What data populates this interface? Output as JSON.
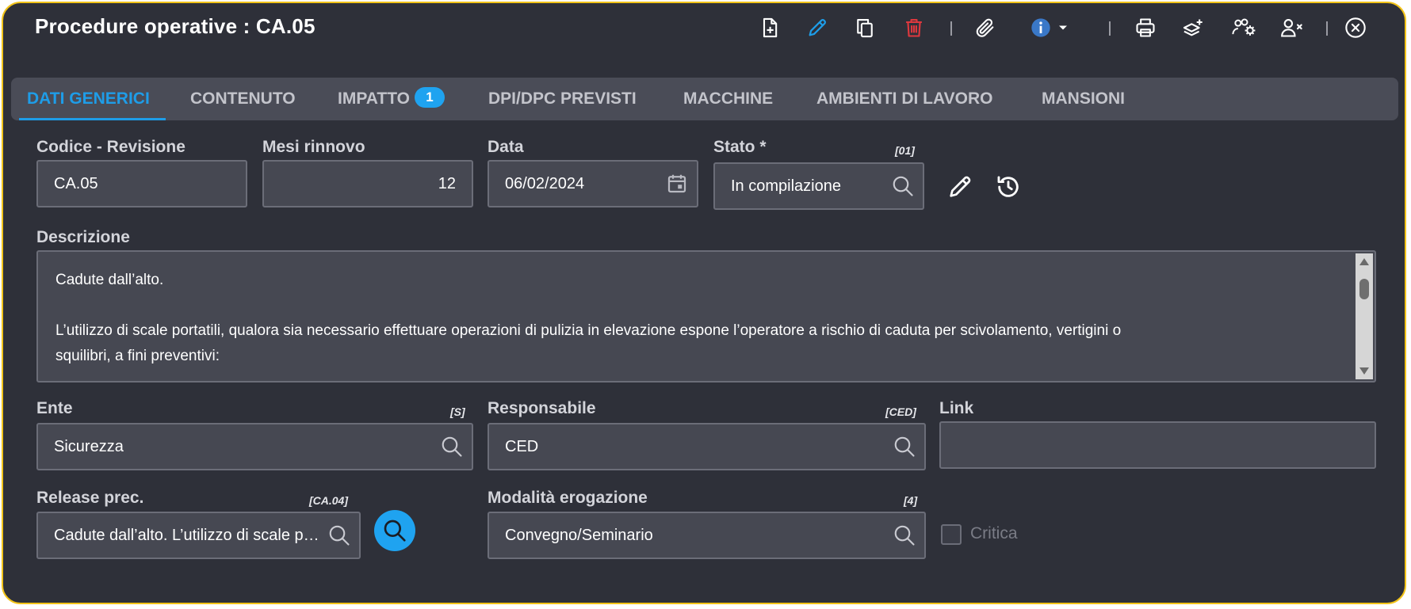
{
  "window": {
    "title": "Procedure operative : CA.05"
  },
  "toolbar": {
    "icons": [
      "new-document-icon",
      "edit-pencil-icon",
      "copy-icon",
      "delete-trash-icon",
      "attachment-icon",
      "info-icon",
      "chevron-down-icon",
      "print-icon",
      "layers-add-icon",
      "users-settings-icon",
      "user-remove-icon",
      "close-circle-icon"
    ]
  },
  "tabs": [
    {
      "label": "DATI GENERICI",
      "active": true
    },
    {
      "label": "CONTENUTO"
    },
    {
      "label": "IMPATTO",
      "badge": "1"
    },
    {
      "label": "DPI/DPC PREVISTI"
    },
    {
      "label": "MACCHINE"
    },
    {
      "label": "AMBIENTI DI LAVORO"
    },
    {
      "label": "MANSIONI"
    }
  ],
  "form": {
    "codice": {
      "label": "Codice - Revisione",
      "value": "CA.05"
    },
    "mesi": {
      "label": "Mesi rinnovo",
      "value": "12"
    },
    "data": {
      "label": "Data",
      "value": "06/02/2024"
    },
    "stato": {
      "label": "Stato *",
      "code": "[01]",
      "value": "In compilazione"
    },
    "descrizione": {
      "label": "Descrizione",
      "line1": "Cadute dall’alto.",
      "line2": "L’utilizzo di scale portatili, qualora sia necessario effettuare operazioni di pulizia in elevazione espone l’operatore a rischio di caduta per scivolamento, vertigini o",
      "line3": "squilibri, a fini preventivi:"
    },
    "ente": {
      "label": "Ente",
      "code": "[S]",
      "value": "Sicurezza"
    },
    "responsabile": {
      "label": "Responsabile",
      "code": "[CED]",
      "value": "CED"
    },
    "link": {
      "label": "Link",
      "value": ""
    },
    "release": {
      "label": "Release prec.",
      "code": "[CA.04]",
      "value": "Cadute dall’alto.  L’utilizzo di scale portatili"
    },
    "modalita": {
      "label": "Modalità erogazione",
      "code": "[4]",
      "value": "Convegno/Seminario"
    },
    "critica": {
      "label": "Critica",
      "checked": false
    }
  },
  "colors": {
    "accent": "#1e9de8",
    "border": "#f2c318",
    "delete": "#e0383e",
    "background": "#2e3039"
  }
}
